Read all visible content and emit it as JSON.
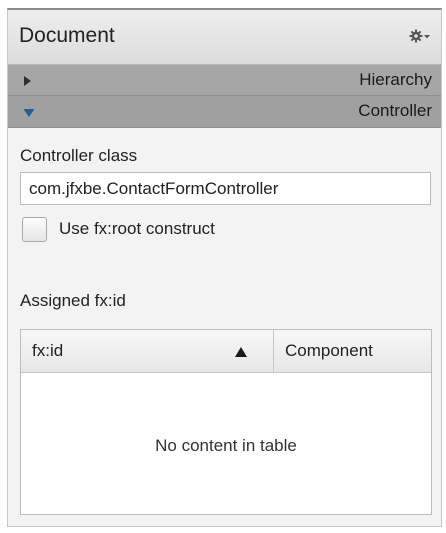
{
  "header": {
    "title": "Document",
    "menu_icon": "gear-icon"
  },
  "sections": {
    "hierarchy": {
      "label": "Hierarchy",
      "state": "collapsed"
    },
    "controller": {
      "label": "Controller",
      "state": "expanded"
    }
  },
  "controller": {
    "class_label": "Controller class",
    "class_value": "com.jfxbe.ContactFormController",
    "root_construct_label": "Use fx:root construct",
    "root_construct_checked": false
  },
  "assigned": {
    "label": "Assigned fx:id",
    "columns": [
      "fx:id",
      "Component"
    ],
    "empty_text": "No content in table"
  },
  "colors": {
    "section_bar": "#a6a6a6",
    "expanded_arrow": "#1f5f9a"
  }
}
